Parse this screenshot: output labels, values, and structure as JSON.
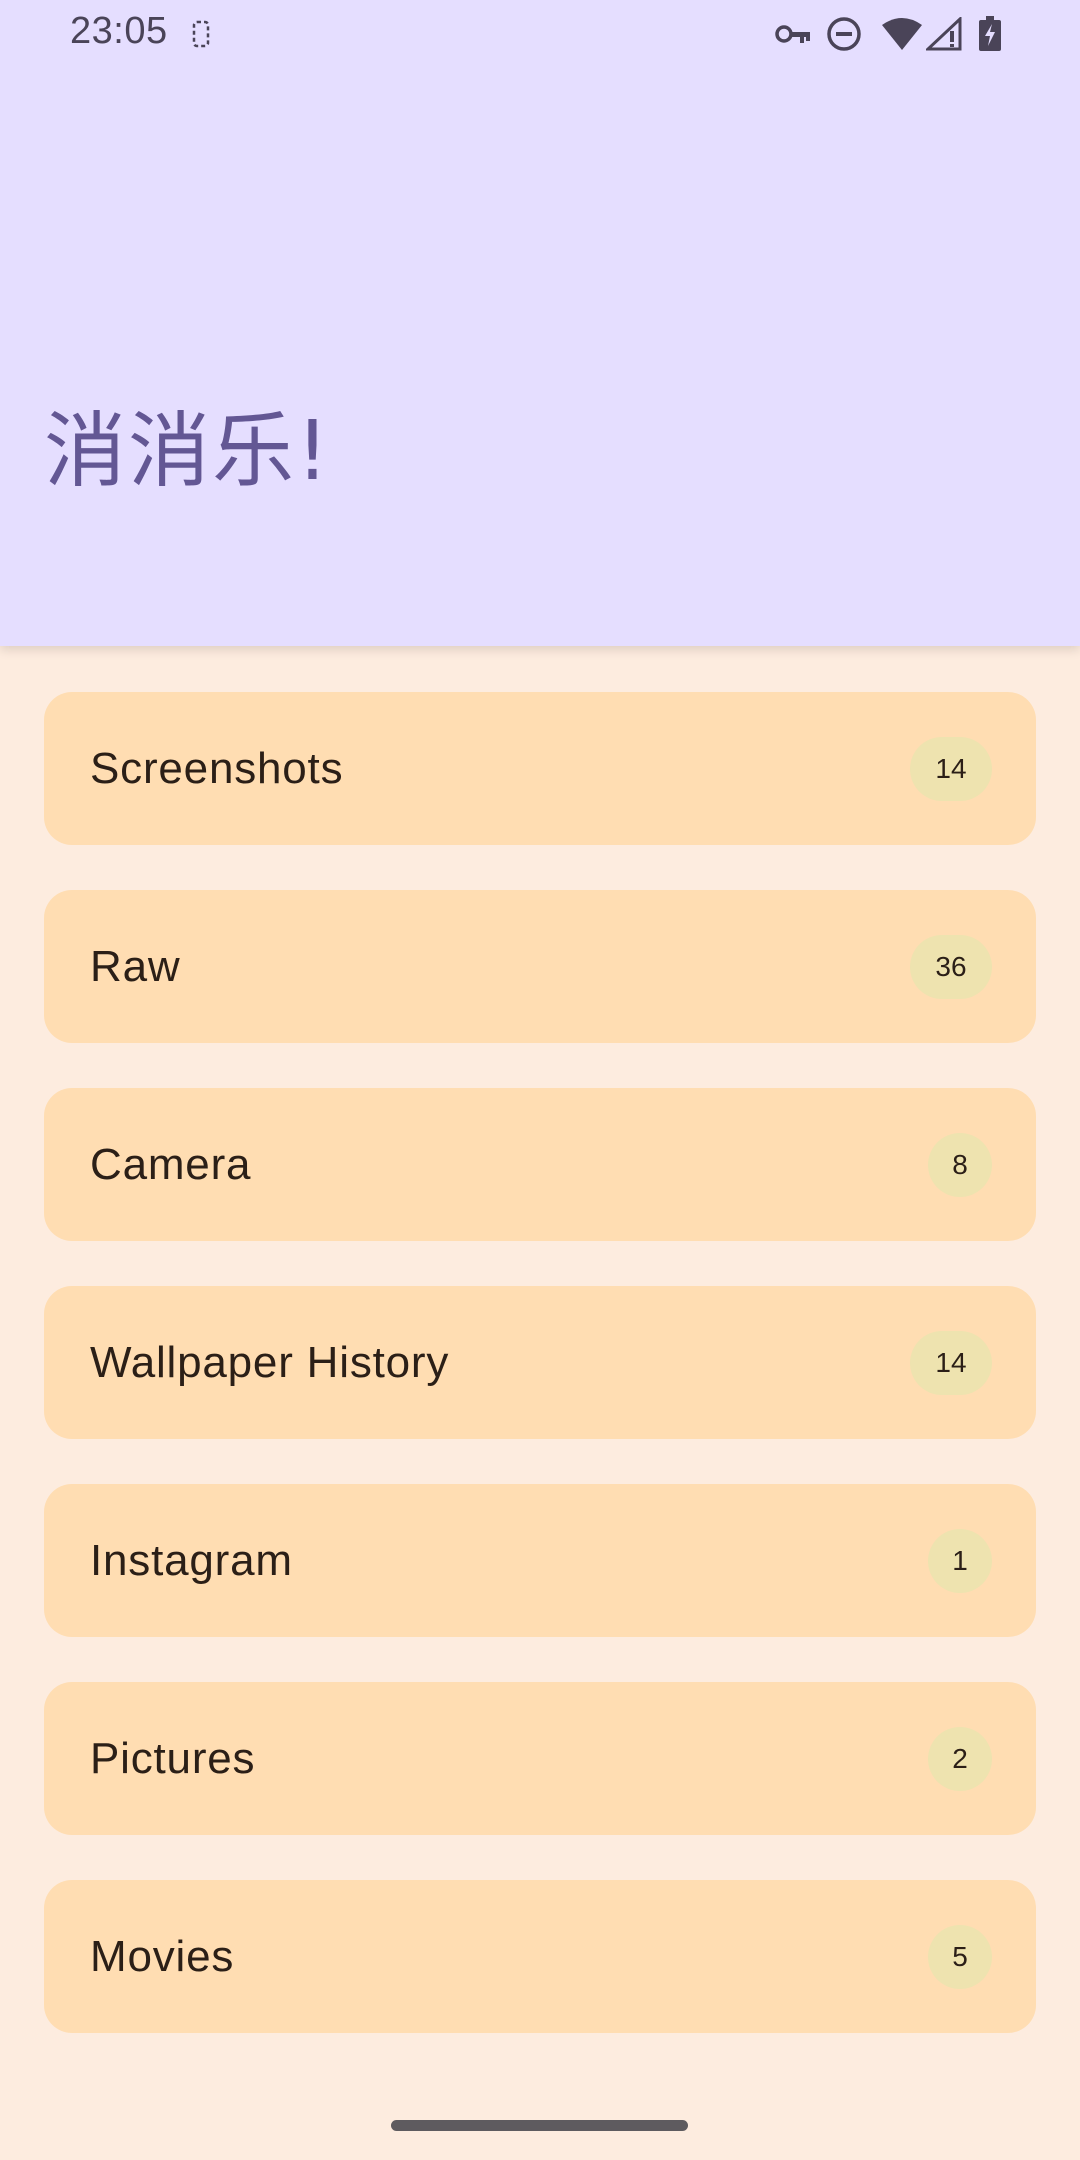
{
  "status_bar": {
    "time": "23:05",
    "icons": [
      "screen-record-icon",
      "vpn-key-icon",
      "do-not-disturb-icon",
      "wifi-icon",
      "cellular-signal-icon",
      "battery-charging-icon"
    ]
  },
  "app": {
    "title": "消消乐!"
  },
  "albums": [
    {
      "name": "Screenshots",
      "count": "14"
    },
    {
      "name": "Raw",
      "count": "36"
    },
    {
      "name": "Camera",
      "count": "8"
    },
    {
      "name": "Wallpaper History",
      "count": "14"
    },
    {
      "name": "Instagram",
      "count": "1"
    },
    {
      "name": "Pictures",
      "count": "2"
    },
    {
      "name": "Movies",
      "count": "5"
    }
  ],
  "colors": {
    "header_bg": "#E5DEFF",
    "title_text": "#635794",
    "page_bg": "#FDECDF",
    "card_bg": "#FFDDB2",
    "badge_bg": "#EEE3AF"
  }
}
